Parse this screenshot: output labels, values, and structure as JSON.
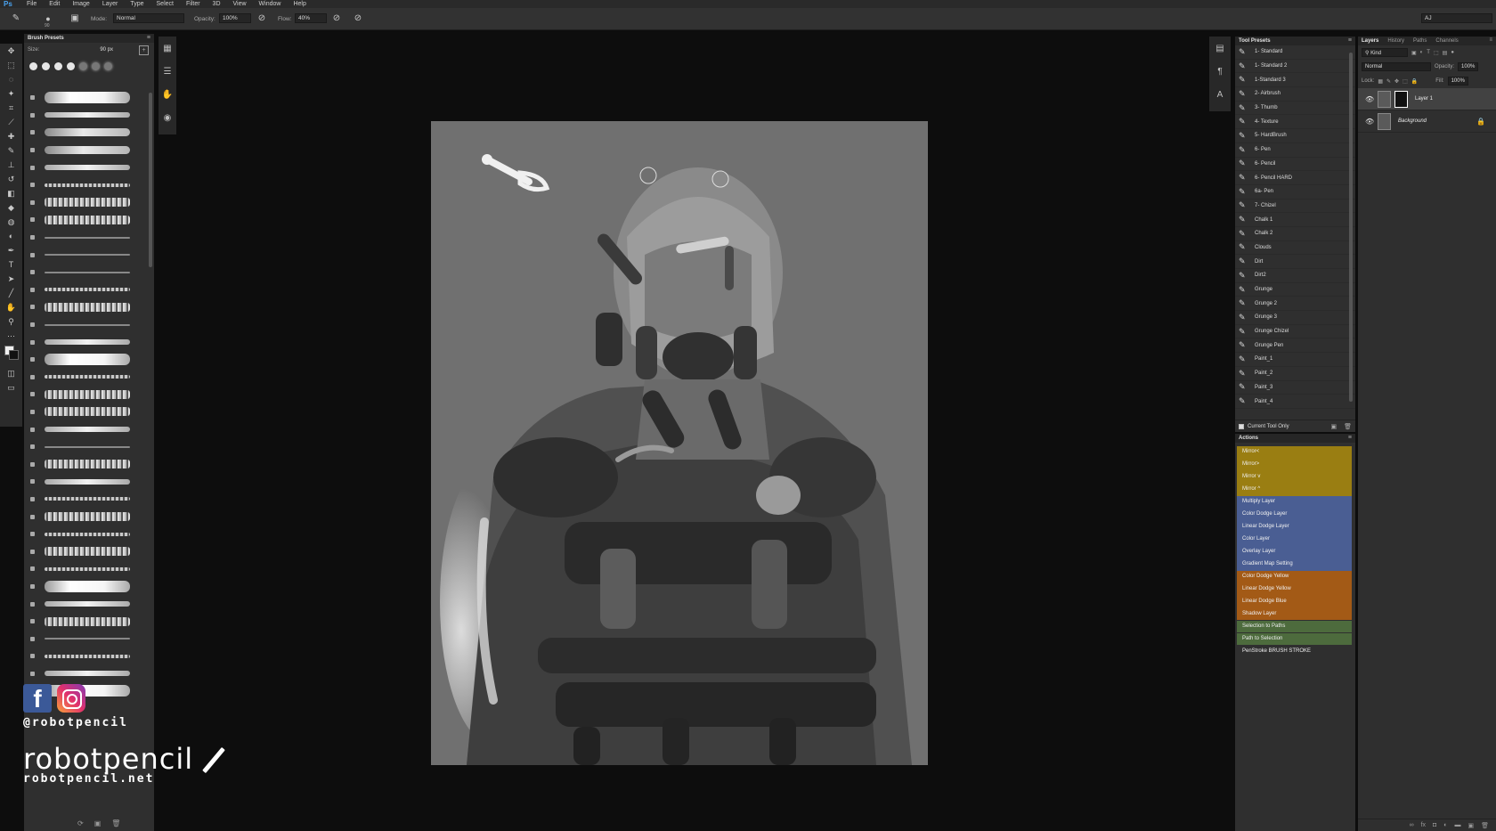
{
  "app": {
    "logo": "Ps"
  },
  "menu": [
    "File",
    "Edit",
    "Image",
    "Layer",
    "Type",
    "Select",
    "Filter",
    "3D",
    "View",
    "Window",
    "Help"
  ],
  "options_bar": {
    "brush_size": "90",
    "mode_label": "Mode:",
    "mode_value": "Normal",
    "opacity_label": "Opacity:",
    "opacity_value": "100%",
    "flow_label": "Flow:",
    "flow_value": "40%",
    "workspace_value": "AJ"
  },
  "tools": [
    "move-icon",
    "marquee-icon",
    "lasso-icon",
    "magic-wand-icon",
    "crop-icon",
    "eyedropper-icon",
    "healing-icon",
    "brush-icon",
    "stamp-icon",
    "history-brush-icon",
    "eraser-icon",
    "bucket-icon",
    "blur-icon",
    "dodge-icon",
    "pen-icon",
    "type-icon",
    "path-select-icon",
    "shape-icon",
    "hand-icon",
    "zoom-icon",
    "more-icon"
  ],
  "brush_presets": {
    "title": "Brush Presets",
    "size_label": "Size:",
    "size_value": "90 px",
    "strokes": [
      "t6",
      "t3",
      "t1",
      "t1",
      "t3",
      "t2",
      "t4",
      "t4",
      "t5",
      "t5",
      "t5",
      "t2",
      "t4",
      "t5",
      "t3",
      "t6",
      "t2",
      "t4",
      "t4",
      "t3",
      "t5",
      "t4",
      "t3",
      "t2",
      "t4",
      "t2",
      "t4",
      "t2",
      "t6",
      "t3",
      "t4",
      "t5",
      "t2",
      "t3",
      "t6"
    ]
  },
  "tool_presets": {
    "title": "Tool Presets",
    "items": [
      "1- Standard",
      "1- Standard 2",
      "1-Standard 3",
      "2- Airbrush",
      "3- Thumb",
      "4- Texture",
      "5- HardBrush",
      "6- Pen",
      "6- Pencil",
      "6- Pencil HARD",
      "6a- Pen",
      "7- Chizel",
      "Chalk 1",
      "Chalk 2",
      "Clouds",
      "Dirt",
      "Dirt2",
      "Grunge",
      "Grunge 2",
      "Grunge 3",
      "Grunge Chizel",
      "Grunge Pen",
      "Paint_1",
      "Paint_2",
      "Paint_3",
      "Paint_4"
    ],
    "current_tool_only": "Current Tool Only"
  },
  "actions": {
    "title": "Actions",
    "items": [
      {
        "label": "Mirror<",
        "color": "#9a7e12"
      },
      {
        "label": "Mirror>",
        "color": "#9a7e12"
      },
      {
        "label": "Mirror v",
        "color": "#9a7e12"
      },
      {
        "label": "Mirror ^",
        "color": "#9a7e12"
      },
      {
        "label": "Multiply Layer",
        "color": "#4a5e93"
      },
      {
        "label": "Color Dodge Layer",
        "color": "#4a5e93"
      },
      {
        "label": "Linear Dodge Layer",
        "color": "#4a5e93"
      },
      {
        "label": "Color Layer",
        "color": "#4a5e93"
      },
      {
        "label": "Overlay Layer",
        "color": "#4a5e93"
      },
      {
        "label": "Gradient Map Setting",
        "color": "#4a5e93"
      },
      {
        "label": "Color Dodge Yellow",
        "color": "#a35a16"
      },
      {
        "label": "Linear Dodge Yellow",
        "color": "#a35a16"
      },
      {
        "label": "Linear Dodge Blue",
        "color": "#a35a16"
      },
      {
        "label": "Shadow Layer",
        "color": "#a35a16"
      },
      {
        "label": "Selection to Paths",
        "color": "#4d6b3d"
      },
      {
        "label": "Path to Selection",
        "color": "#4d6b3d"
      },
      {
        "label": "PenStroke BRUSH STROKE",
        "color": "#2f2f2f"
      }
    ]
  },
  "layers": {
    "tabs": [
      "Layers",
      "History",
      "Paths",
      "Channels"
    ],
    "kind_label": "Kind",
    "blend_mode": "Normal",
    "opacity_label": "Opacity:",
    "opacity_value": "100%",
    "lock_label": "Lock:",
    "fill_label": "Fill:",
    "fill_value": "100%",
    "items": [
      {
        "name": "Layer 1",
        "selected": true
      },
      {
        "name": "Background",
        "selected": false
      }
    ]
  },
  "watermark": {
    "handle": "@robotpencil",
    "brand": "robotpencil",
    "site": "robotpencil.net"
  }
}
